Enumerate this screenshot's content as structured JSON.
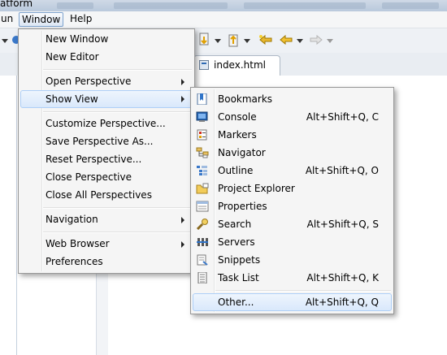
{
  "title": {
    "text": "atform"
  },
  "menubar": {
    "run": "un",
    "window": "Window",
    "help": "Help"
  },
  "tabs": {
    "index": "index.html"
  },
  "window_menu": {
    "items": [
      {
        "label": "New Window",
        "submenu": false
      },
      {
        "label": "New Editor",
        "submenu": false
      },
      {
        "label": "Open Perspective",
        "submenu": true
      },
      {
        "label": "Show View",
        "submenu": true,
        "highlighted": true
      },
      {
        "label": "Customize Perspective...",
        "submenu": false
      },
      {
        "label": "Save Perspective As...",
        "submenu": false
      },
      {
        "label": "Reset Perspective...",
        "submenu": false
      },
      {
        "label": "Close Perspective",
        "submenu": false
      },
      {
        "label": "Close All Perspectives",
        "submenu": false
      },
      {
        "label": "Navigation",
        "submenu": true
      },
      {
        "label": "Web Browser",
        "submenu": true
      },
      {
        "label": "Preferences",
        "submenu": false
      }
    ]
  },
  "show_view_menu": {
    "items": [
      {
        "label": "Bookmarks",
        "shortcut": "",
        "icon": "bookmarks-icon"
      },
      {
        "label": "Console",
        "shortcut": "Alt+Shift+Q, C",
        "icon": "console-icon"
      },
      {
        "label": "Markers",
        "shortcut": "",
        "icon": "markers-icon"
      },
      {
        "label": "Navigator",
        "shortcut": "",
        "icon": "navigator-icon"
      },
      {
        "label": "Outline",
        "shortcut": "Alt+Shift+Q, O",
        "icon": "outline-icon"
      },
      {
        "label": "Project Explorer",
        "shortcut": "",
        "icon": "project-explorer-icon"
      },
      {
        "label": "Properties",
        "shortcut": "",
        "icon": "properties-icon"
      },
      {
        "label": "Search",
        "shortcut": "Alt+Shift+Q, S",
        "icon": "search-icon"
      },
      {
        "label": "Servers",
        "shortcut": "",
        "icon": "servers-icon"
      },
      {
        "label": "Snippets",
        "shortcut": "",
        "icon": "snippets-icon"
      },
      {
        "label": "Task List",
        "shortcut": "Alt+Shift+Q, K",
        "icon": "task-list-icon"
      },
      {
        "label": "Other...",
        "shortcut": "Alt+Shift+Q, Q",
        "highlighted": true
      }
    ]
  },
  "colors": {
    "highlight": "#d9e8fb",
    "highlight_border": "#aecff7",
    "menu_bg": "#f5f5f5"
  }
}
